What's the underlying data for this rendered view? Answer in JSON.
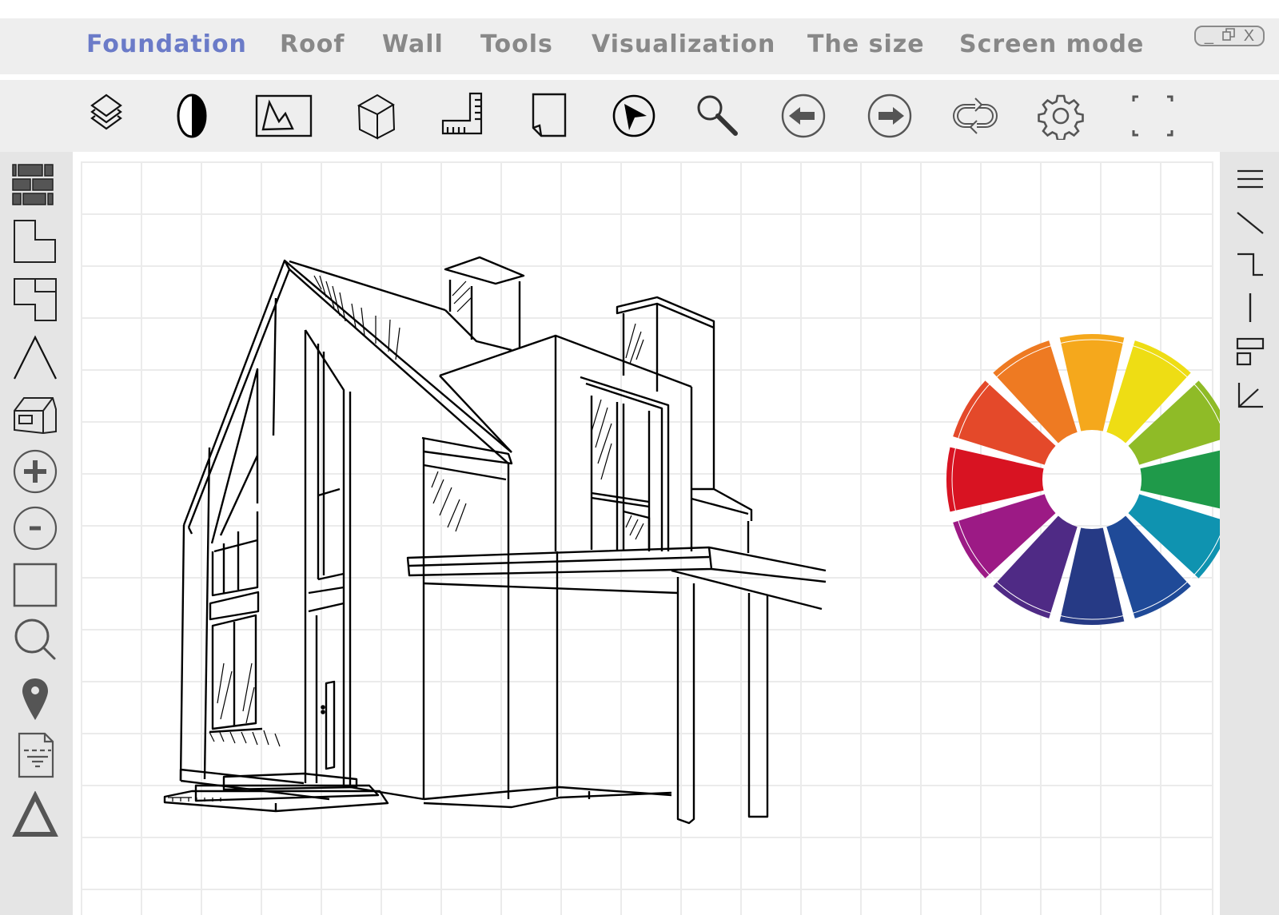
{
  "window_controls": {
    "minimize": "_",
    "restore": "🗗",
    "close": "X"
  },
  "menu": {
    "active_color": "#6b7bc8",
    "inactive_color": "#888888",
    "items": [
      {
        "label": "Foundation",
        "active": true
      },
      {
        "label": "Roof",
        "active": false
      },
      {
        "label": "Wall",
        "active": false
      },
      {
        "label": "Tools",
        "active": false
      },
      {
        "label": "Visualization",
        "active": false
      },
      {
        "label": "The size",
        "active": false
      },
      {
        "label": "Screen mode",
        "active": false
      }
    ]
  },
  "toolbar": {
    "tools": [
      {
        "icon": "layers-icon"
      },
      {
        "icon": "contrast-icon"
      },
      {
        "icon": "image-icon"
      },
      {
        "icon": "cube-icon"
      },
      {
        "icon": "ruler-icon"
      },
      {
        "icon": "page-icon"
      },
      {
        "icon": "cursor-icon"
      },
      {
        "icon": "zoom-icon"
      },
      {
        "icon": "arrow-left-icon"
      },
      {
        "icon": "arrow-right-icon"
      },
      {
        "icon": "repeat-icon"
      },
      {
        "icon": "settings-gear-icon"
      },
      {
        "icon": "fullscreen-icon"
      }
    ]
  },
  "left_tools": [
    {
      "icon": "brick-wall-icon"
    },
    {
      "icon": "l-shape-floor-icon"
    },
    {
      "icon": "floor-plan-icon"
    },
    {
      "icon": "roof-angle-icon"
    },
    {
      "icon": "house-3d-icon"
    },
    {
      "icon": "zoom-in-icon"
    },
    {
      "icon": "zoom-out-icon"
    },
    {
      "icon": "rectangle-icon"
    },
    {
      "icon": "search-icon"
    },
    {
      "icon": "location-pin-icon"
    },
    {
      "icon": "document-icon"
    },
    {
      "icon": "triangle-icon"
    }
  ],
  "right_tools": [
    {
      "icon": "menu-lines-icon"
    },
    {
      "icon": "diagonal-line-icon"
    },
    {
      "icon": "step-line-icon"
    },
    {
      "icon": "vertical-line-icon"
    },
    {
      "icon": "align-blocks-icon"
    },
    {
      "icon": "arrow-down-left-icon"
    }
  ],
  "color_wheel": {
    "segments": [
      "#f5a81c",
      "#eedd14",
      "#8fbb27",
      "#1f9a4a",
      "#0f93b0",
      "#1f4a98",
      "#263a85",
      "#4f2a85",
      "#9c1a85",
      "#d81322",
      "#e4492a",
      "#ee7a22"
    ]
  }
}
